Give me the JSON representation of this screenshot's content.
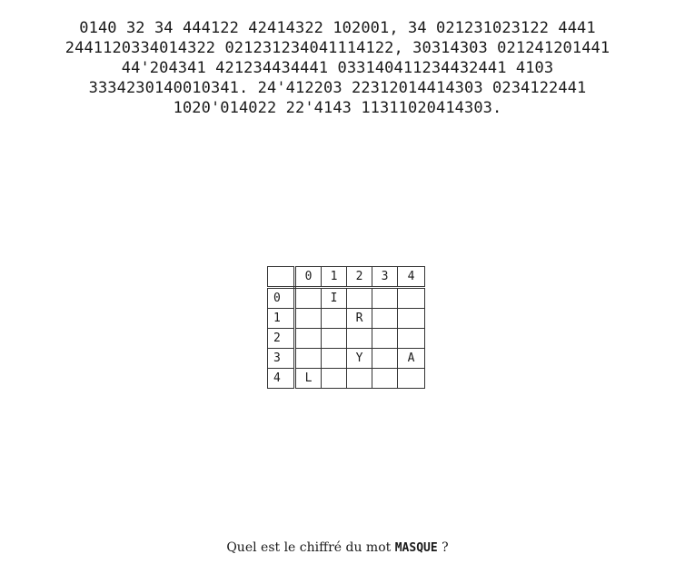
{
  "cipher_lines": [
    "0140 32 34 444122 42414322 102001, 34 021231023122 4441",
    "2441120334014322 021231234041114122, 30314303 021241201441",
    "44'204341 421234434441 033140411234432441 4103",
    "3334230140010341. 24'412203 22312014414303 0234122441",
    "1020'014022 22'4143 11311020414303."
  ],
  "grid": {
    "col_headers": [
      "0",
      "1",
      "2",
      "3",
      "4"
    ],
    "rows": [
      {
        "header": "0",
        "cells": [
          "",
          "I",
          "",
          "",
          ""
        ]
      },
      {
        "header": "1",
        "cells": [
          "",
          "",
          "R",
          "",
          ""
        ]
      },
      {
        "header": "2",
        "cells": [
          "",
          "",
          "",
          "",
          ""
        ]
      },
      {
        "header": "3",
        "cells": [
          "",
          "",
          "Y",
          "",
          "A"
        ]
      },
      {
        "header": "4",
        "cells": [
          "L",
          "",
          "",
          "",
          ""
        ]
      }
    ]
  },
  "question": {
    "prefix": "Quel est le chiffré du mot ",
    "word": "MASQUE",
    "suffix": " ?"
  }
}
